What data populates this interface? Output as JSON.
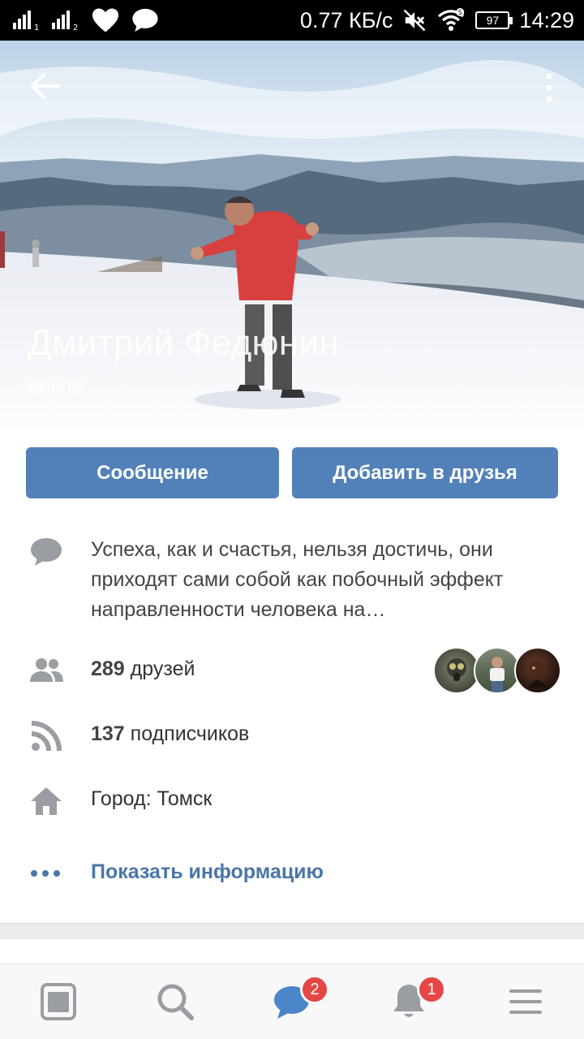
{
  "status_bar": {
    "sim1": "1",
    "sim2": "2",
    "speed": "0.77 КБ/с",
    "battery": "97",
    "time": "14:29"
  },
  "profile": {
    "name": "Дмитрий Федюнин",
    "status": "online"
  },
  "actions": {
    "message_label": "Сообщение",
    "add_friend_label": "Добавить в друзья"
  },
  "info": {
    "quote": "Успеха, как и счастья, нельзя достичь, они приходят сами собой как побочный эффект направленности человека на…",
    "friends_count": "289",
    "friends_label": "друзей",
    "followers_count": "137",
    "followers_label": "подписчиков",
    "city": "Город: Томск",
    "show_info_label": "Показать информацию"
  },
  "bottom_nav": {
    "messages_badge": "2",
    "notifications_badge": "1"
  },
  "colors": {
    "accent": "#5281b9",
    "link": "#4a76a8",
    "badge": "#e64646",
    "icon_gray": "#9a9ea3"
  },
  "icons": [
    "back-arrow-icon",
    "more-vertical-icon",
    "comment-icon",
    "friends-icon",
    "rss-icon",
    "home-icon",
    "more-horizontal-icon",
    "news-icon",
    "search-icon",
    "messages-icon",
    "bell-icon",
    "menu-icon"
  ]
}
